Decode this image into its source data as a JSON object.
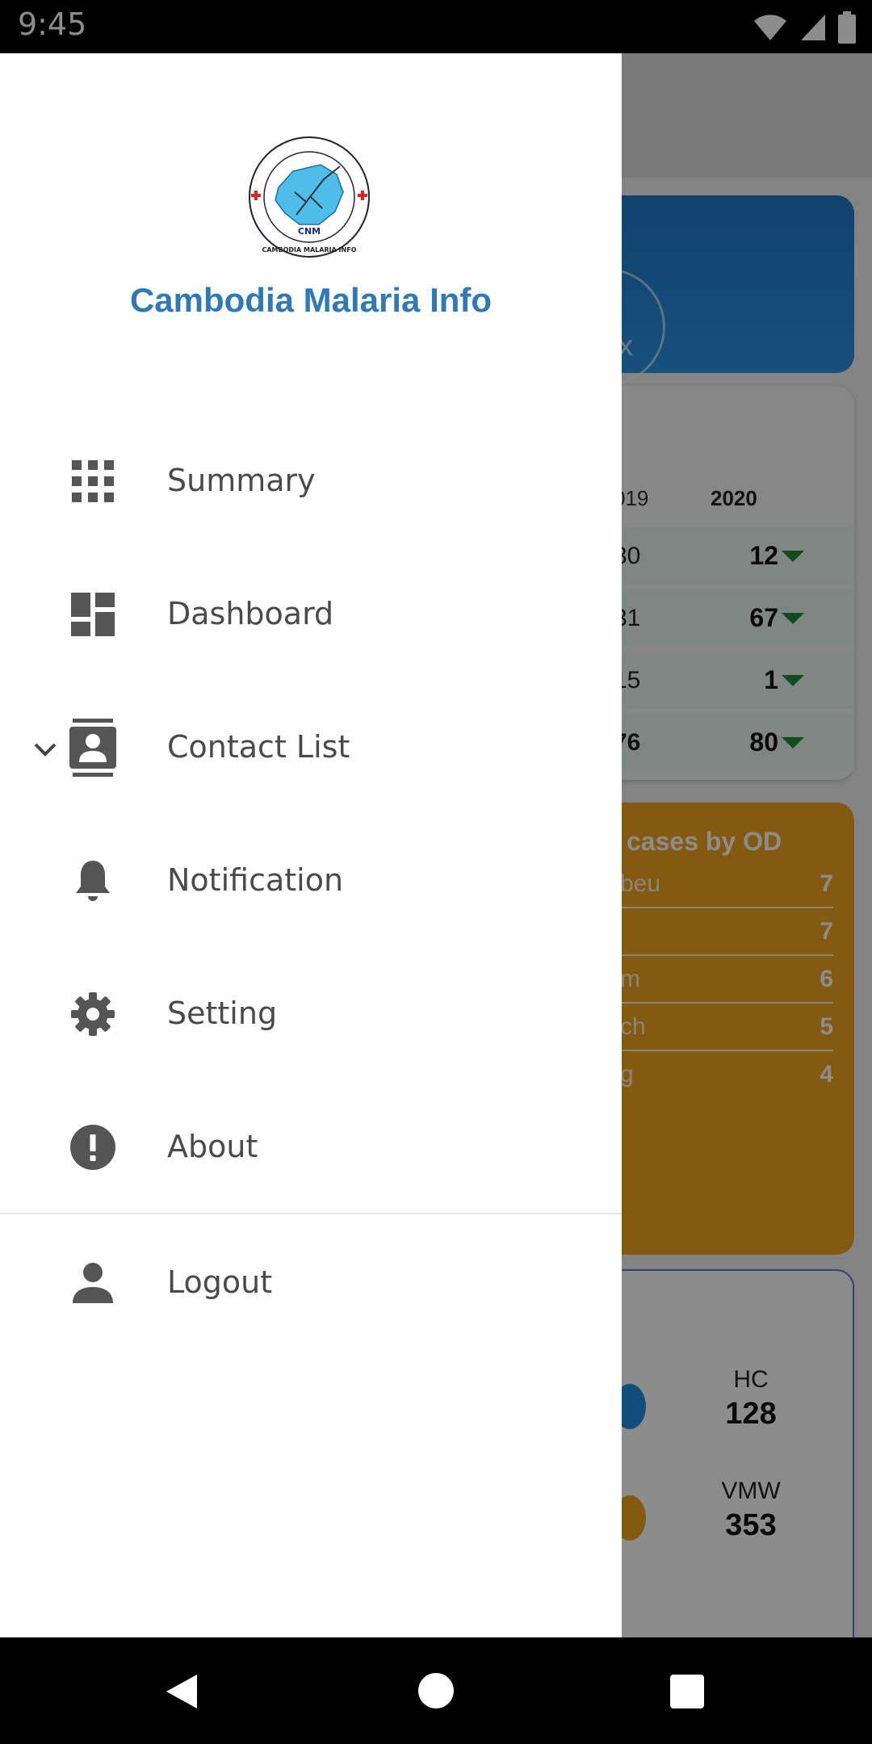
{
  "status_bar": {
    "time": "9:45",
    "icons": [
      "wifi-icon",
      "signal-icon",
      "battery-icon"
    ]
  },
  "app": {
    "table": {
      "headers": [
        "019",
        "2020"
      ],
      "rows": [
        {
          "prev": "30",
          "cur": "12",
          "trend": "down"
        },
        {
          "prev": "31",
          "cur": "67",
          "trend": "down"
        },
        {
          "prev": "15",
          "cur": "1",
          "trend": "down"
        },
        {
          "prev": "76",
          "cur": "80",
          "trend": "down"
        }
      ]
    },
    "od_card": {
      "title": "cases by OD",
      "rows": [
        {
          "name": "beu",
          "count": "7"
        },
        {
          "name": "",
          "count": "7"
        },
        {
          "name": "m",
          "count": "6"
        },
        {
          "name": "ch",
          "count": "5"
        },
        {
          "name": "g",
          "count": "4"
        }
      ]
    },
    "stats": [
      {
        "label": "HC",
        "value": "128"
      },
      {
        "label": "VMW",
        "value": "353"
      }
    ],
    "blue_card": {
      "glyph": "x"
    },
    "colors": {
      "blue": "#1e79c9",
      "orange": "#f0a21e",
      "green": "#1e8a3b",
      "purple": "#6c6fd1"
    }
  },
  "drawer": {
    "title": "Cambodia Malaria Info",
    "logo": {
      "center": "CNM",
      "ring": "CAMBODIA MALARIA INFO"
    },
    "title_color": "#2f79b6",
    "items": [
      {
        "label": "Summary",
        "icon": "apps-grid-icon"
      },
      {
        "label": "Dashboard",
        "icon": "dashboard-icon"
      },
      {
        "label": "Contact List",
        "icon": "contacts-icon",
        "expandable": true
      },
      {
        "label": "Notification",
        "icon": "bell-icon"
      },
      {
        "label": "Setting",
        "icon": "gear-icon"
      },
      {
        "label": "About",
        "icon": "info-alert-icon"
      },
      {
        "label": "Logout",
        "icon": "person-icon"
      }
    ]
  },
  "nav_bar": {
    "buttons": [
      "back-icon",
      "home-icon",
      "recents-icon"
    ]
  }
}
